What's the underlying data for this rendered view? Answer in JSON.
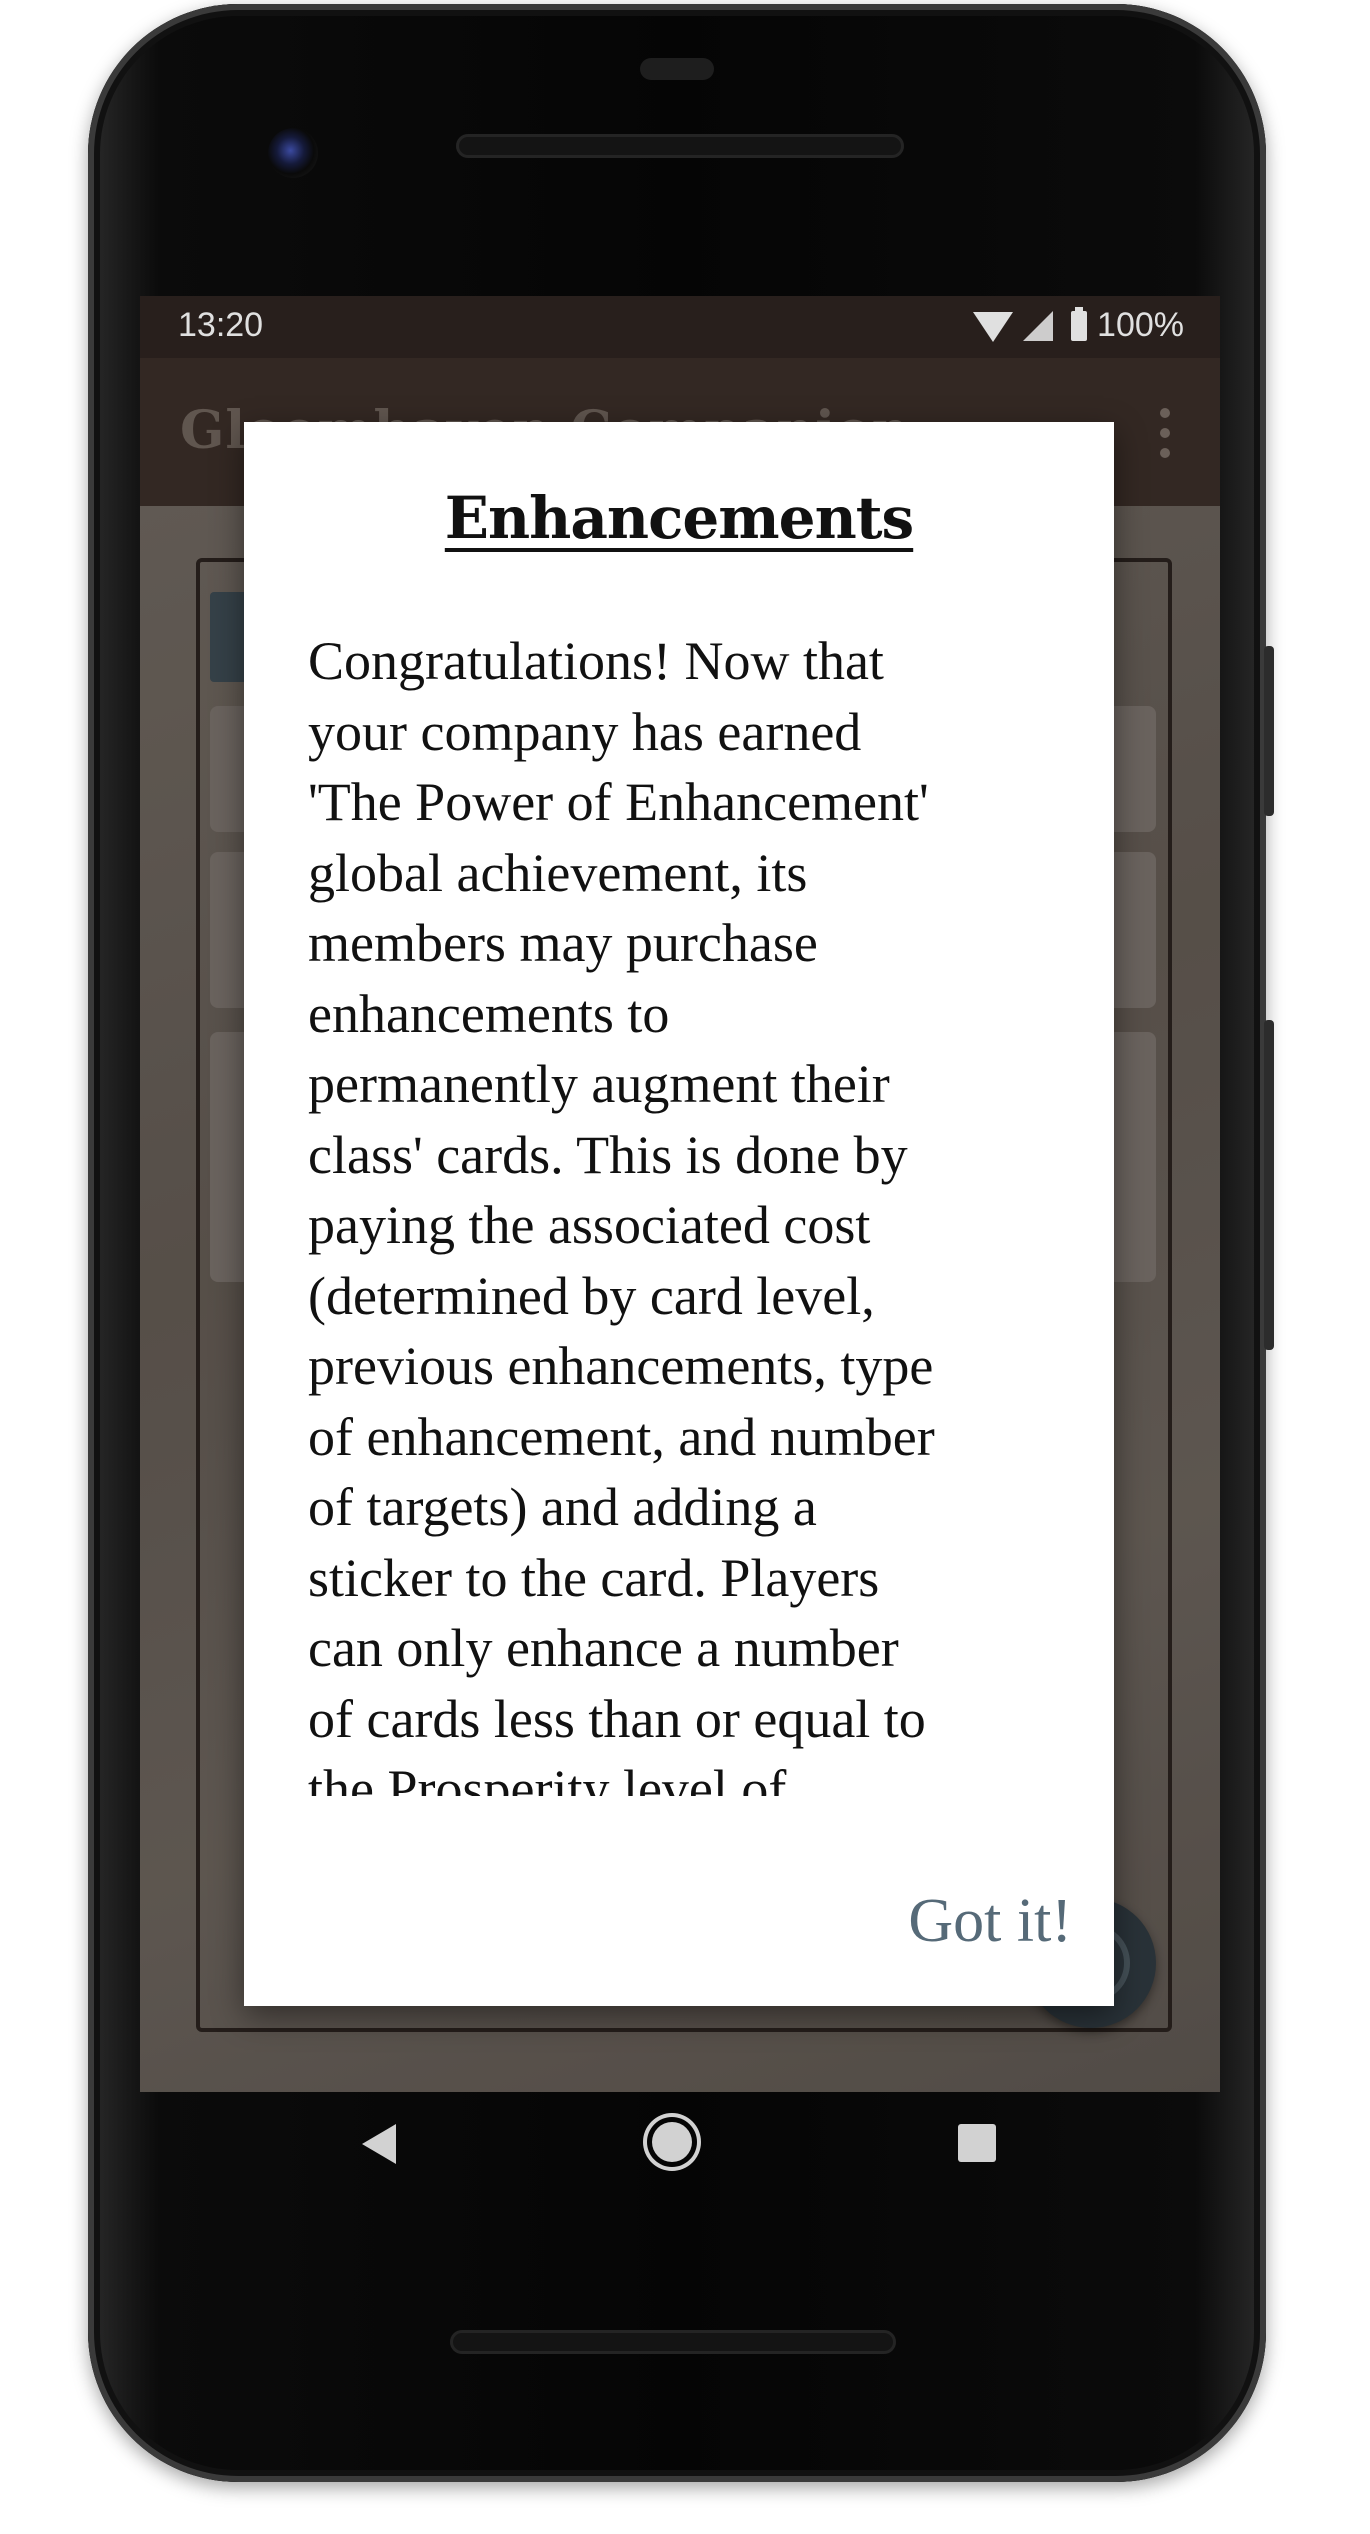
{
  "status_bar": {
    "time": "13:20",
    "battery": "100%",
    "icons": [
      "wifi-icon",
      "cell-signal-icon",
      "battery-icon"
    ]
  },
  "app_bar": {
    "title": "Gloomhaven Companion",
    "menu_icon": "overflow-menu-icon"
  },
  "dialog": {
    "title": "Enhancements",
    "body": "Congratulations! Now that\nyour company has earned\n'The Power of Enhancement'\nglobal achievement, its\nmembers may purchase\nenhancements to\npermanently augment their\nclass' cards. This is done by\npaying the associated cost\n(determined by card level,\nprevious enhancements, type\nof enhancement, and number\nof targets) and adding a\nsticker to the card. Players\ncan only enhance a number\nof cards less than or equal to\nthe Prosperity level of",
    "button_label": "Got it!"
  },
  "nav_bar": {
    "icons": [
      "back-icon",
      "home-icon",
      "recents-icon"
    ]
  },
  "colors": {
    "status_bar": "#2e2420",
    "app_bar": "#3b2e28",
    "dialog_button": "#566a78",
    "fab": "#2f3a40"
  }
}
